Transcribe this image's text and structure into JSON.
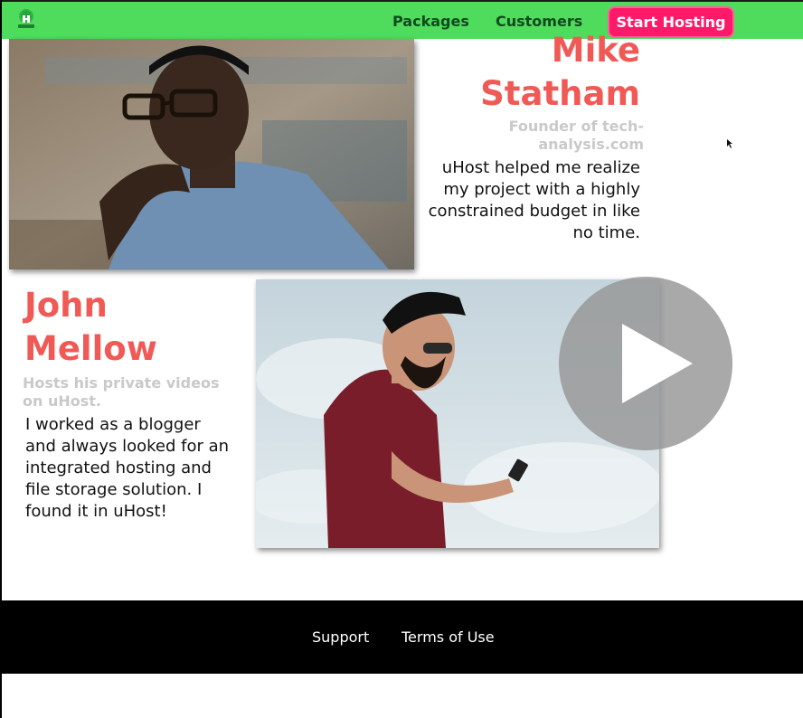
{
  "header": {
    "nav": [
      {
        "label": "Packages"
      },
      {
        "label": "Customers"
      }
    ],
    "cta_label": "Start Hosting"
  },
  "testimonials": [
    {
      "name_line1": "Mike",
      "name_line2": "Statham",
      "role": "Founder of tech-analysis.com",
      "quote": "uHost helped me realize my project with a highly constrained budget in like no time."
    },
    {
      "name_line1": "John",
      "name_line2": "Mellow",
      "role": "Hosts his private videos on uHost.",
      "quote": "I worked as a blogger and always looked for an integrated hosting and file storage solution. I found it in uHost!"
    }
  ],
  "footer": {
    "links": [
      {
        "label": "Support"
      },
      {
        "label": "Terms of Use"
      }
    ]
  },
  "colors": {
    "header_bg": "#4fdc5c",
    "cta_bg": "#ff1a69",
    "name_color": "#f05a56",
    "footer_bg": "#000000"
  },
  "icons": [
    "uhost-logo-icon",
    "play-icon",
    "mouse-cursor-icon"
  ]
}
